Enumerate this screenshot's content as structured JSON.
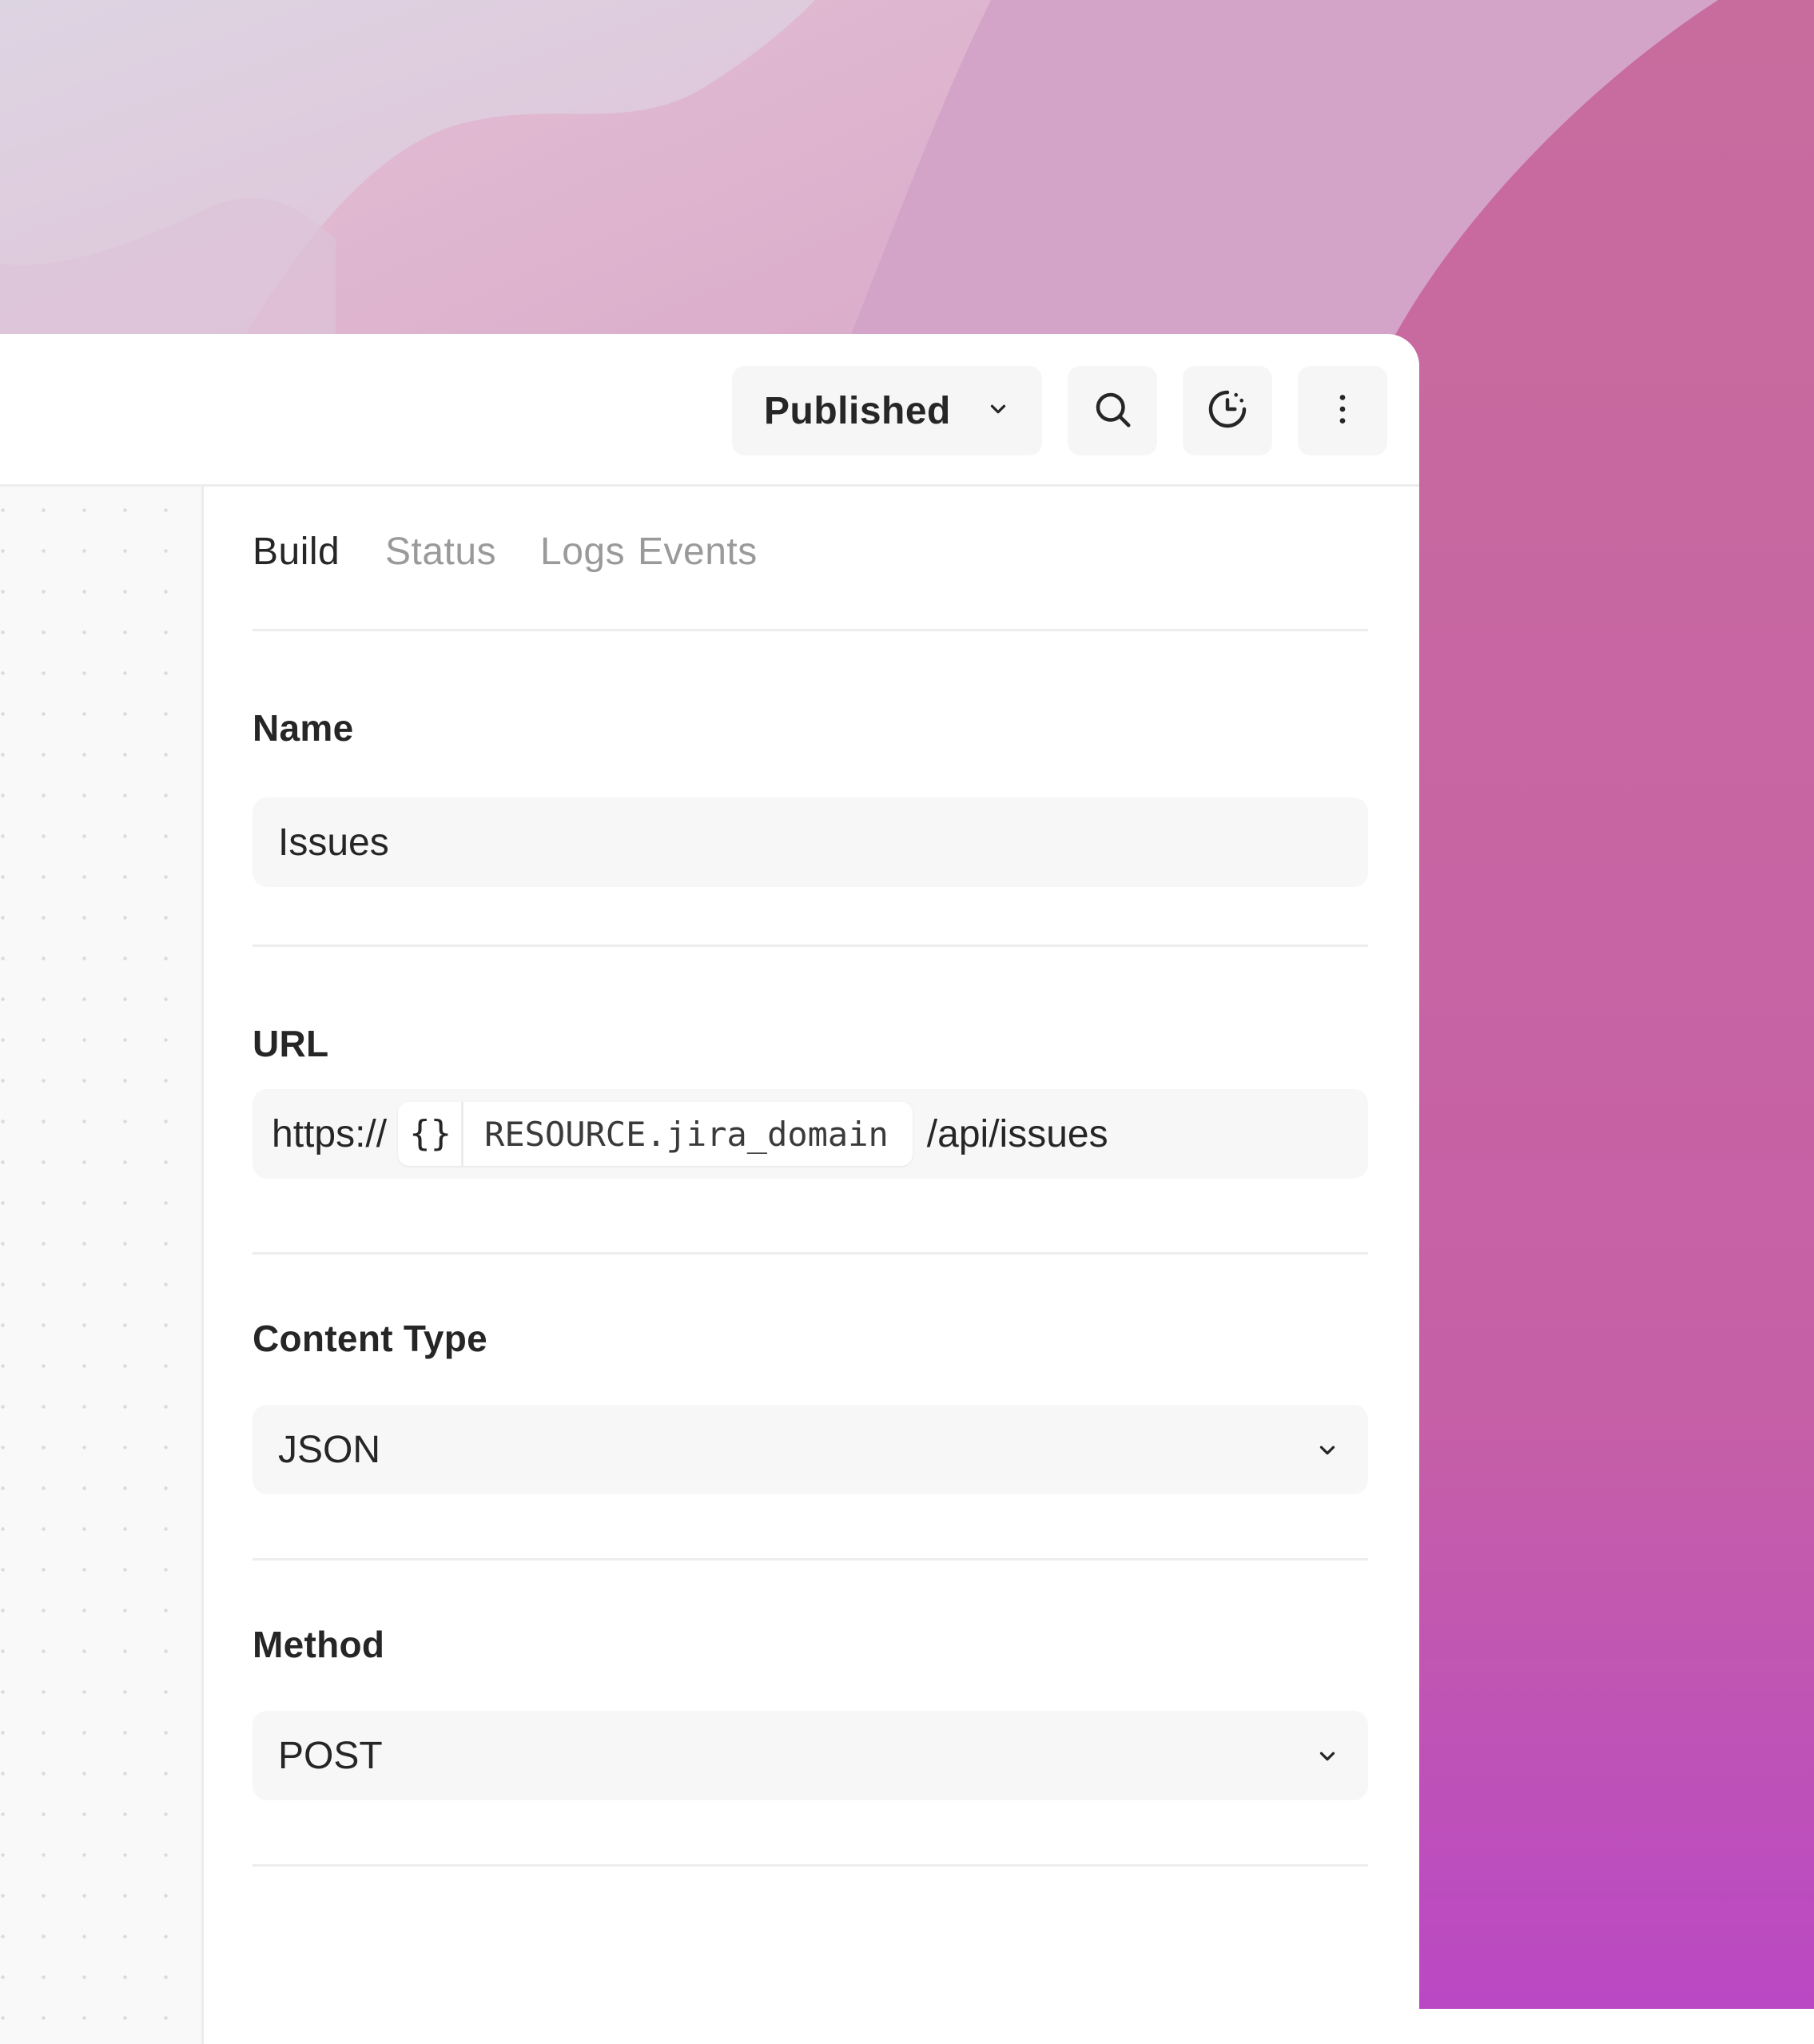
{
  "toolbar": {
    "status_label": "Published",
    "icons": [
      "chevron-down-icon",
      "search-icon",
      "history-icon",
      "more-vertical-icon"
    ]
  },
  "tabs": [
    {
      "label": "Build",
      "active": true
    },
    {
      "label": "Status",
      "active": false
    },
    {
      "label": "Logs",
      "active": false
    },
    {
      "label": "Events",
      "active": false
    }
  ],
  "form": {
    "name": {
      "label": "Name",
      "value": "Issues"
    },
    "url": {
      "label": "URL",
      "prefix": "https://",
      "variable_braces": "{}",
      "variable": "RESOURCE.jira_domain",
      "suffix": "/api/issues"
    },
    "content_type": {
      "label": "Content Type",
      "value": "JSON"
    },
    "method": {
      "label": "Method",
      "value": "POST"
    }
  },
  "colors": {
    "wallpaper_pink": "#cf72a6",
    "wallpaper_lilac": "#dcc6d8",
    "window_bg": "#ffffff",
    "field_bg": "#f7f7f7",
    "active_tab": "#262626",
    "inactive_tab": "#9a9a9a"
  }
}
